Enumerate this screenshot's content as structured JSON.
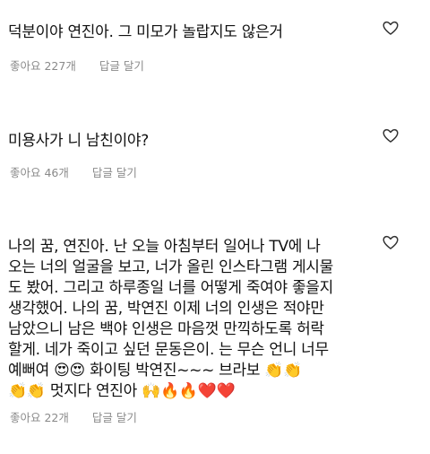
{
  "comments": [
    {
      "text": "덕분이야 연진아. 그 미모가 놀랍지도 않은거",
      "likes": "좋아요 227개",
      "reply": "답글 달기"
    },
    {
      "text": "미용사가 니 남친이야?",
      "likes": "좋아요 46개",
      "reply": "답글 달기"
    },
    {
      "text": "나의 꿈, 연진아. 난 오늘 아침부터 일어나 TV에 나\n오는 너의 얼굴을 보고, 너가 올린 인스타그램 게시물\n도 봤어. 그리고 하루종일 너를 어떻게 죽여야 좋을지\n생각했어. 나의 꿈, 박연진 이제 너의 인생은 적야만\n남았으니 남은 백야 인생은 마음껏 만끽하도록 허락\n할게. 네가 죽이고 싶던 문동은이. 는 무슨 언니 너무\n예뻐여 😍😍 화이팅 박연진~~~ 브라보 👏👏\n👏👏 멋지다 연진아 🙌🔥🔥❤️❤️",
      "likes": "좋아요 22개",
      "reply": "답글 달기"
    }
  ],
  "icons": {
    "like": "heart-outline-icon"
  }
}
